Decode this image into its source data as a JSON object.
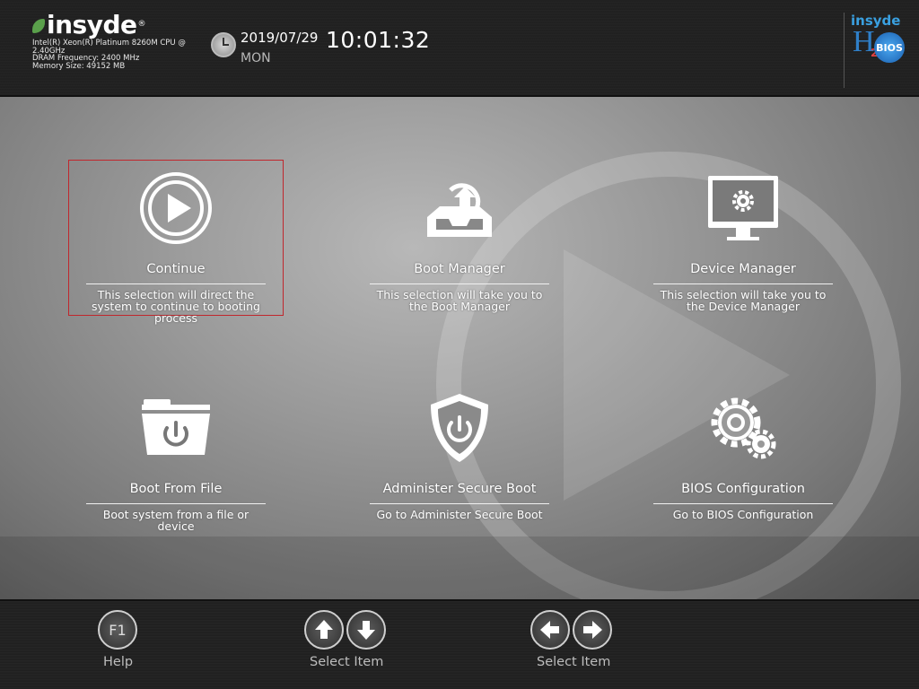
{
  "header": {
    "brand": "insyde",
    "brand_mark": "®",
    "cpu_line": "Intel(R) Xeon(R) Platinum 8260M CPU @ 2.40GHz",
    "dram_line": "DRAM Frequency: 2400 MHz",
    "memory_line": "Memory Size: 49152 MB",
    "date": "2019/07/29",
    "weekday": "MON",
    "time": "10:01:32",
    "product_logo": {
      "insyde": "insyde",
      "h": "H",
      "two": "2",
      "bios": "BIOS"
    }
  },
  "tiles": [
    {
      "title": "Continue",
      "description": "This selection will direct the system to continue to booting process",
      "icon": "play-icon",
      "selected": true
    },
    {
      "title": "Boot Manager",
      "description": "This selection will take you to the Boot Manager",
      "icon": "boot-manager-icon",
      "selected": false
    },
    {
      "title": "Device Manager",
      "description": "This selection will take you to the Device Manager",
      "icon": "monitor-gear-icon",
      "selected": false
    },
    {
      "title": "Boot From File",
      "description": "Boot system from a file or device",
      "icon": "folder-power-icon",
      "selected": false
    },
    {
      "title": "Administer Secure Boot",
      "description": "Go to Administer Secure Boot",
      "icon": "shield-power-icon",
      "selected": false
    },
    {
      "title": "BIOS Configuration",
      "description": "Go to BIOS Configuration",
      "icon": "gears-icon",
      "selected": false
    }
  ],
  "footer": {
    "help": {
      "key": "F1",
      "label": "Help"
    },
    "select_vertical": {
      "label": "Select Item"
    },
    "select_horizontal": {
      "label": "Select Item"
    }
  },
  "colors": {
    "selection_border": "#c0272d",
    "brand_green": "#5aa04b",
    "brand_blue": "#2f7fc8"
  }
}
